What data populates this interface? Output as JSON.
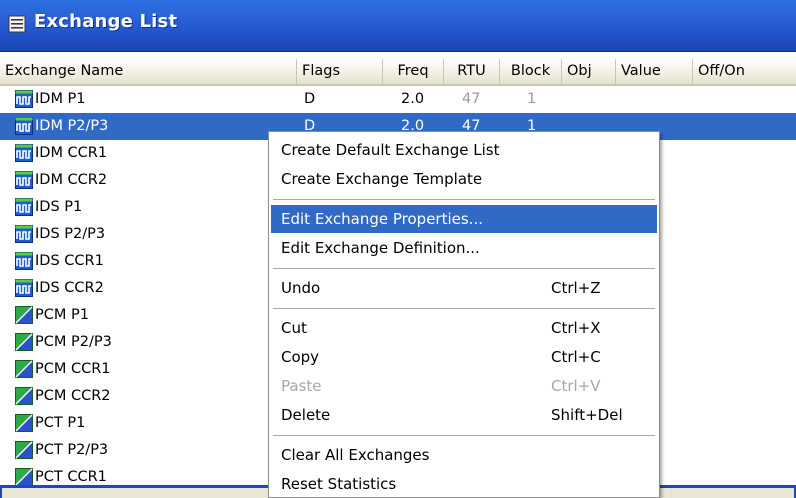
{
  "window": {
    "title": "Exchange List",
    "icon": "list-window-icon"
  },
  "columns": [
    {
      "key": "name",
      "label": "Exchange Name"
    },
    {
      "key": "flags",
      "label": "Flags"
    },
    {
      "key": "freq",
      "label": "Freq"
    },
    {
      "key": "rtu",
      "label": "RTU"
    },
    {
      "key": "block",
      "label": "Block"
    },
    {
      "key": "obj",
      "label": "Obj"
    },
    {
      "key": "value",
      "label": "Value"
    },
    {
      "key": "offon",
      "label": "Off/On"
    }
  ],
  "rows": [
    {
      "icon": "idm-icon",
      "name": "IDM P1",
      "flags": "D",
      "freq": "2.0",
      "rtu": "47",
      "block": "1",
      "selected": false
    },
    {
      "icon": "idm-icon",
      "name": "IDM P2/P3",
      "flags": "D",
      "freq": "2.0",
      "rtu": "47",
      "block": "1",
      "selected": true
    },
    {
      "icon": "idm-icon",
      "name": "IDM CCR1"
    },
    {
      "icon": "idm-icon",
      "name": "IDM CCR2"
    },
    {
      "icon": "idm-icon",
      "name": "IDS P1"
    },
    {
      "icon": "idm-icon",
      "name": "IDS P2/P3"
    },
    {
      "icon": "idm-icon",
      "name": "IDS CCR1"
    },
    {
      "icon": "idm-icon",
      "name": "IDS CCR2"
    },
    {
      "icon": "pcm-icon",
      "name": "PCM P1"
    },
    {
      "icon": "pcm-icon",
      "name": "PCM P2/P3"
    },
    {
      "icon": "pcm-icon",
      "name": "PCM CCR1"
    },
    {
      "icon": "pcm-icon",
      "name": "PCM CCR2"
    },
    {
      "icon": "pcm-icon",
      "name": "PCT P1"
    },
    {
      "icon": "pcm-icon",
      "name": "PCT P2/P3"
    },
    {
      "icon": "pcm-icon",
      "name": "PCT CCR1"
    }
  ],
  "context_menu": {
    "items": [
      {
        "label": "Create Default Exchange List",
        "shortcut": ""
      },
      {
        "label": "Create Exchange Template",
        "shortcut": ""
      },
      {
        "separator": true
      },
      {
        "label": "Edit Exchange Properties...",
        "shortcut": "",
        "highlighted": true
      },
      {
        "label": "Edit Exchange Definition...",
        "shortcut": ""
      },
      {
        "separator": true
      },
      {
        "label": "Undo",
        "shortcut": "Ctrl+Z"
      },
      {
        "separator": true
      },
      {
        "label": "Cut",
        "shortcut": "Ctrl+X"
      },
      {
        "label": "Copy",
        "shortcut": "Ctrl+C"
      },
      {
        "label": "Paste",
        "shortcut": "Ctrl+V",
        "disabled": true
      },
      {
        "label": "Delete",
        "shortcut": "Shift+Del"
      },
      {
        "separator": true
      },
      {
        "label": "Clear All Exchanges",
        "shortcut": ""
      },
      {
        "label": "Reset Statistics",
        "shortcut": ""
      }
    ]
  },
  "colors": {
    "title_bar": "#2b63d7",
    "selection": "#316ac5",
    "idm_icon": "#1d5fd1",
    "pcm_icon": "#2ea84a"
  }
}
